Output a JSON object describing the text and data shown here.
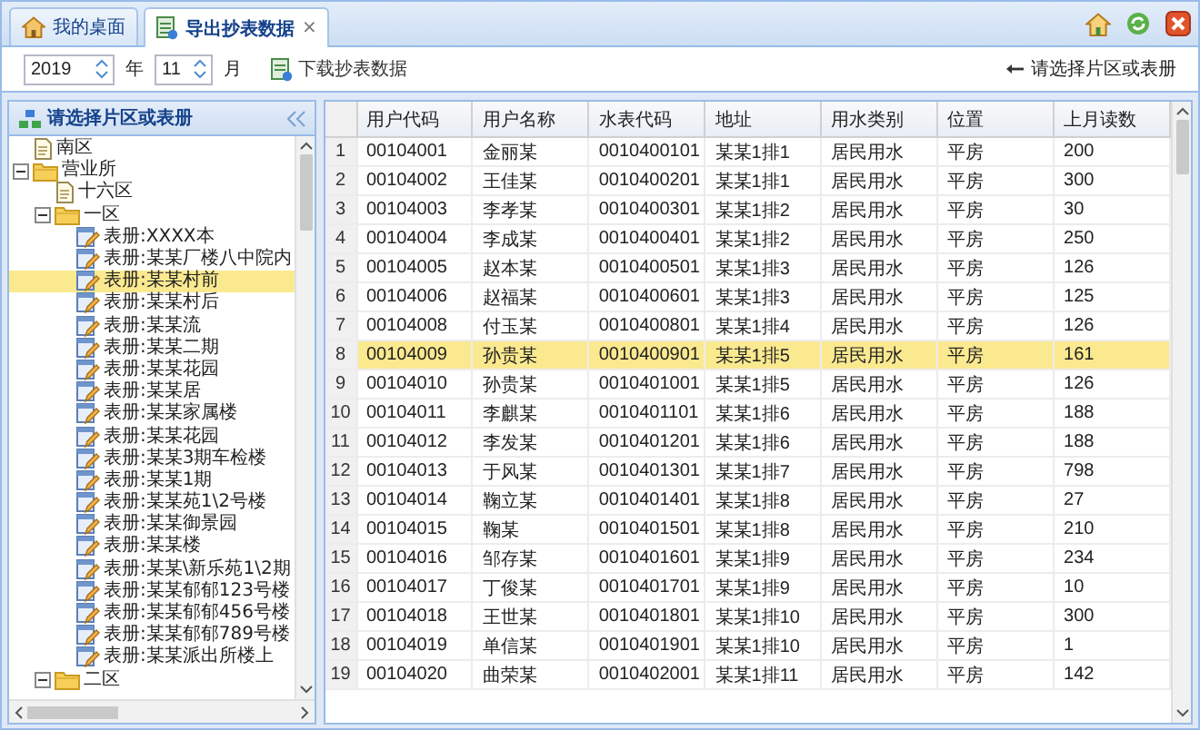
{
  "tabs": [
    {
      "label": "我的桌面",
      "selected": false
    },
    {
      "label": "导出抄表数据",
      "selected": true,
      "close": "×"
    }
  ],
  "toolbar": {
    "year": "2019",
    "year_unit": "年",
    "month": "11",
    "month_unit": "月",
    "download_button": "下载抄表数据",
    "hint": "请选择片区或表册"
  },
  "tree_panel": {
    "title": "请选择片区或表册",
    "nodes": [
      {
        "label": "南区",
        "kind": "area",
        "selected": false
      },
      {
        "label": "营业所",
        "kind": "folder",
        "expanded": true,
        "selected": false,
        "children": [
          {
            "label": "十六区",
            "kind": "area",
            "selected": false
          },
          {
            "label": "一区",
            "kind": "folder",
            "expanded": true,
            "selected": false,
            "children": [
              {
                "label": "表册:XXXX本",
                "kind": "book",
                "selected": false
              },
              {
                "label": "表册:某某厂楼八中院内",
                "kind": "book",
                "selected": false
              },
              {
                "label": "表册:某某村前",
                "kind": "book",
                "selected": true
              },
              {
                "label": "表册:某某村后",
                "kind": "book",
                "selected": false
              },
              {
                "label": "表册:某某流",
                "kind": "book",
                "selected": false
              },
              {
                "label": "表册:某某二期",
                "kind": "book",
                "selected": false
              },
              {
                "label": "表册:某某花园",
                "kind": "book",
                "selected": false
              },
              {
                "label": "表册:某某居",
                "kind": "book",
                "selected": false
              },
              {
                "label": "表册:某某家属楼",
                "kind": "book",
                "selected": false
              },
              {
                "label": "表册:某某花园",
                "kind": "book",
                "selected": false
              },
              {
                "label": "表册:某某3期车检楼",
                "kind": "book",
                "selected": false
              },
              {
                "label": "表册:某某1期",
                "kind": "book",
                "selected": false
              },
              {
                "label": "表册:某某苑1\\2号楼",
                "kind": "book",
                "selected": false
              },
              {
                "label": "表册:某某御景园",
                "kind": "book",
                "selected": false
              },
              {
                "label": "表册:某某楼",
                "kind": "book",
                "selected": false
              },
              {
                "label": "表册:某某\\新乐苑1\\2期",
                "kind": "book",
                "selected": false
              },
              {
                "label": "表册:某某郁郁123号楼",
                "kind": "book",
                "selected": false
              },
              {
                "label": "表册:某某郁郁456号楼",
                "kind": "book",
                "selected": false
              },
              {
                "label": "表册:某某郁郁789号楼",
                "kind": "book",
                "selected": false
              },
              {
                "label": "表册:某某派出所楼上",
                "kind": "book",
                "selected": false
              }
            ]
          },
          {
            "label": "二区",
            "kind": "folder",
            "expanded": true,
            "selected": false
          }
        ]
      }
    ]
  },
  "table": {
    "columns": [
      "用户代码",
      "用户名称",
      "水表代码",
      "地址",
      "用水类别",
      "位置",
      "上月读数"
    ],
    "rows": [
      {
        "number": "1",
        "selected": false,
        "cells": [
          "00104001",
          "金丽某",
          "0010400101",
          "某某1排1",
          "居民用水",
          "平房",
          "200"
        ]
      },
      {
        "number": "2",
        "selected": false,
        "cells": [
          "00104002",
          "王佳某",
          "0010400201",
          "某某1排1",
          "居民用水",
          "平房",
          "300"
        ]
      },
      {
        "number": "3",
        "selected": false,
        "cells": [
          "00104003",
          "李孝某",
          "0010400301",
          "某某1排2",
          "居民用水",
          "平房",
          "30"
        ]
      },
      {
        "number": "4",
        "selected": false,
        "cells": [
          "00104004",
          "李成某",
          "0010400401",
          "某某1排2",
          "居民用水",
          "平房",
          "250"
        ]
      },
      {
        "number": "5",
        "selected": false,
        "cells": [
          "00104005",
          "赵本某",
          "0010400501",
          "某某1排3",
          "居民用水",
          "平房",
          "126"
        ]
      },
      {
        "number": "6",
        "selected": false,
        "cells": [
          "00104006",
          "赵福某",
          "0010400601",
          "某某1排3",
          "居民用水",
          "平房",
          "125"
        ]
      },
      {
        "number": "7",
        "selected": false,
        "cells": [
          "00104008",
          "付玉某",
          "0010400801",
          "某某1排4",
          "居民用水",
          "平房",
          "126"
        ]
      },
      {
        "number": "8",
        "selected": true,
        "cells": [
          "00104009",
          "孙贵某",
          "0010400901",
          "某某1排5",
          "居民用水",
          "平房",
          "161"
        ]
      },
      {
        "number": "9",
        "selected": false,
        "cells": [
          "00104010",
          "孙贵某",
          "0010401001",
          "某某1排5",
          "居民用水",
          "平房",
          "126"
        ]
      },
      {
        "number": "10",
        "selected": false,
        "cells": [
          "00104011",
          "李麒某",
          "0010401101",
          "某某1排6",
          "居民用水",
          "平房",
          "188"
        ]
      },
      {
        "number": "11",
        "selected": false,
        "cells": [
          "00104012",
          "李发某",
          "0010401201",
          "某某1排6",
          "居民用水",
          "平房",
          "188"
        ]
      },
      {
        "number": "12",
        "selected": false,
        "cells": [
          "00104013",
          "于风某",
          "0010401301",
          "某某1排7",
          "居民用水",
          "平房",
          "798"
        ]
      },
      {
        "number": "13",
        "selected": false,
        "cells": [
          "00104014",
          "鞠立某",
          "0010401401",
          "某某1排8",
          "居民用水",
          "平房",
          "27"
        ]
      },
      {
        "number": "14",
        "selected": false,
        "cells": [
          "00104015",
          "鞠某",
          "0010401501",
          "某某1排8",
          "居民用水",
          "平房",
          "210"
        ]
      },
      {
        "number": "15",
        "selected": false,
        "cells": [
          "00104016",
          "邹存某",
          "0010401601",
          "某某1排9",
          "居民用水",
          "平房",
          "234"
        ]
      },
      {
        "number": "16",
        "selected": false,
        "cells": [
          "00104017",
          "丁俊某",
          "0010401701",
          "某某1排9",
          "居民用水",
          "平房",
          "10"
        ]
      },
      {
        "number": "17",
        "selected": false,
        "cells": [
          "00104018",
          "王世某",
          "0010401801",
          "某某1排10",
          "居民用水",
          "平房",
          "300"
        ]
      },
      {
        "number": "18",
        "selected": false,
        "cells": [
          "00104019",
          "单信某",
          "0010401901",
          "某某1排10",
          "居民用水",
          "平房",
          "1"
        ]
      },
      {
        "number": "19",
        "selected": false,
        "cells": [
          "00104020",
          "曲荣某",
          "0010402001",
          "某某1排11",
          "居民用水",
          "平房",
          "142"
        ]
      }
    ]
  }
}
